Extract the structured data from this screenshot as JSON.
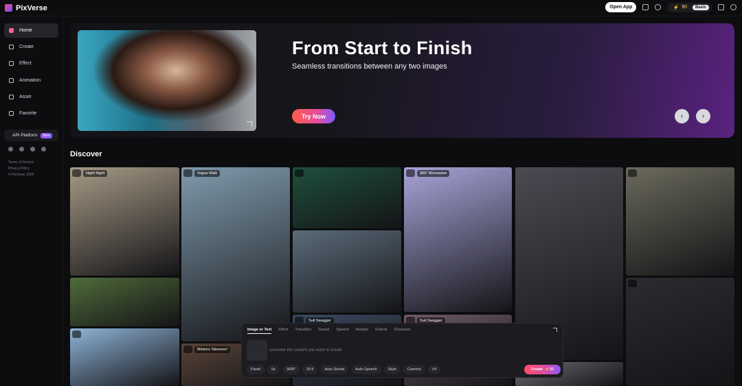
{
  "app": {
    "name": "PixVerse"
  },
  "topbar": {
    "open_app": "Open App",
    "credits": "90",
    "plan": "Basic",
    "icons": [
      "layout-icon",
      "help-icon",
      "download-icon",
      "user-icon"
    ]
  },
  "sidebar": {
    "items": [
      {
        "label": "Home",
        "icon": "home-icon",
        "active": true
      },
      {
        "label": "Create",
        "icon": "video-icon"
      },
      {
        "label": "Effect",
        "icon": "sparkle-icon"
      },
      {
        "label": "Animation",
        "icon": "heart-icon"
      },
      {
        "label": "Asset",
        "icon": "folder-icon"
      },
      {
        "label": "Favorite",
        "icon": "heart-outline-icon"
      }
    ],
    "api": {
      "label": "API Platform",
      "badge": "New"
    },
    "socials": [
      "tiktok-icon",
      "x-icon",
      "youtube-icon",
      "discord-icon"
    ],
    "legal": [
      "Terms of Service",
      "Privacy Policy",
      "© PixVerse 2025"
    ]
  },
  "hero": {
    "title": "From Start to Finish",
    "subtitle": "Seamless transitions between any two images",
    "cta": "Try Now",
    "prev": "‹",
    "next": "›"
  },
  "discover": {
    "title": "Discover",
    "tiles": [
      {
        "label": "Night Night",
        "bg": "#a79a86"
      },
      {
        "label": "Vogue Walk",
        "bg": "#7f9aac"
      },
      {
        "label": "",
        "bg": "#1f4f3c"
      },
      {
        "label": "360° Microwave",
        "bg": "#a7a4d8"
      },
      {
        "label": "",
        "bg": "#4a4b52"
      },
      {
        "label": "",
        "bg": "#6b6a5c"
      },
      {
        "label": "",
        "bg": "#4f6b3a"
      },
      {
        "label": "",
        "bg": "#5b6c7a"
      },
      {
        "label": "Suit Swagger",
        "bg": "#3b4a60"
      },
      {
        "label": "Suit Swagger",
        "bg": "#6f5a66"
      },
      {
        "label": "",
        "bg": "#2a2c2f"
      },
      {
        "label": "",
        "bg": "#8fb4d8"
      },
      {
        "label": "Minions Takeover!",
        "bg": "#5a4438"
      },
      {
        "label": "",
        "bg": "#6b6d70"
      }
    ]
  },
  "composer": {
    "tabs": [
      "Image or Text",
      "Effect",
      "Transition",
      "Sound",
      "Speech",
      "Restyle",
      "Extend",
      "Character"
    ],
    "placeholder": "Describe the content you want to create",
    "controls": [
      "Panel",
      "5s",
      "360P",
      "16:9",
      "Auto Sound",
      "Auto Speech",
      "Style",
      "Camera",
      "V4"
    ],
    "create": "Create",
    "create_cost": "⚡30"
  }
}
